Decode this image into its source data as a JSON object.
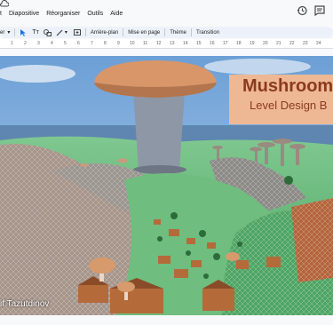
{
  "menu": {
    "items": [
      "t",
      "Diapositive",
      "Réorganiser",
      "Outils",
      "Aide"
    ]
  },
  "toolbar": {
    "zoom_label": "er",
    "background_label": "Arrière-plan",
    "layout_label": "Mise en page",
    "theme_label": "Thème",
    "transition_label": "Transition"
  },
  "ruler": {
    "ticks": [
      "1",
      "2",
      "3",
      "4",
      "5",
      "6",
      "7",
      "8",
      "9",
      "10",
      "11",
      "12",
      "13",
      "14",
      "15",
      "16",
      "17",
      "18",
      "19",
      "20",
      "21",
      "22",
      "23",
      "24"
    ]
  },
  "slide": {
    "title": "Mushroom",
    "subtitle": "Level Design B",
    "author": "if Tazutdinov"
  },
  "colors": {
    "banner": "#f7b98e",
    "title_text": "#8b3a1f",
    "toolbar_bg": "#edf2fa"
  }
}
